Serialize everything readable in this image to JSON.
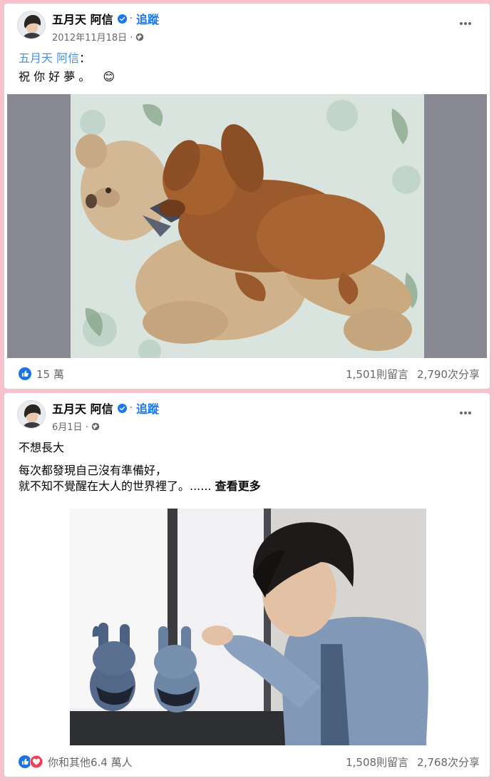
{
  "posts": [
    {
      "author": "五月天 阿信",
      "follow_label": "追蹤",
      "separator": "·",
      "date": "2012年11月18日 ·",
      "mention": "五月天 阿信",
      "mention_suffix": "：",
      "text_line": "祝 你 好 夢 。",
      "emoji": "😊",
      "reaction_count": "15 萬",
      "comments": "1,501則留言",
      "shares": "2,790次分享",
      "photo": "puppy-sleeping-on-teddy-bear"
    },
    {
      "author": "五月天 阿信",
      "follow_label": "追蹤",
      "separator": "·",
      "date": "6月1日 ·",
      "title_line": "不想長大",
      "body_line1": "每次都發現自己沒有準備好，",
      "body_line2": "就不知不覺醒在大人的世界裡了。......",
      "see_more": "查看更多",
      "reaction_count": "你和其他6.4 萬人",
      "comments": "1,508則留言",
      "shares": "2,768次分享",
      "photo": "man-in-denim-jacket-with-plush-rabbits"
    }
  ],
  "colors": {
    "page_background": "#f6c3cd",
    "link_blue": "#1877f2",
    "mention_blue": "#4c8fe0",
    "secondary_text": "#65676b"
  },
  "icons": [
    "verified-badge-icon",
    "globe-icon",
    "more-options-icon",
    "like-reaction-icon",
    "love-reaction-icon"
  ]
}
